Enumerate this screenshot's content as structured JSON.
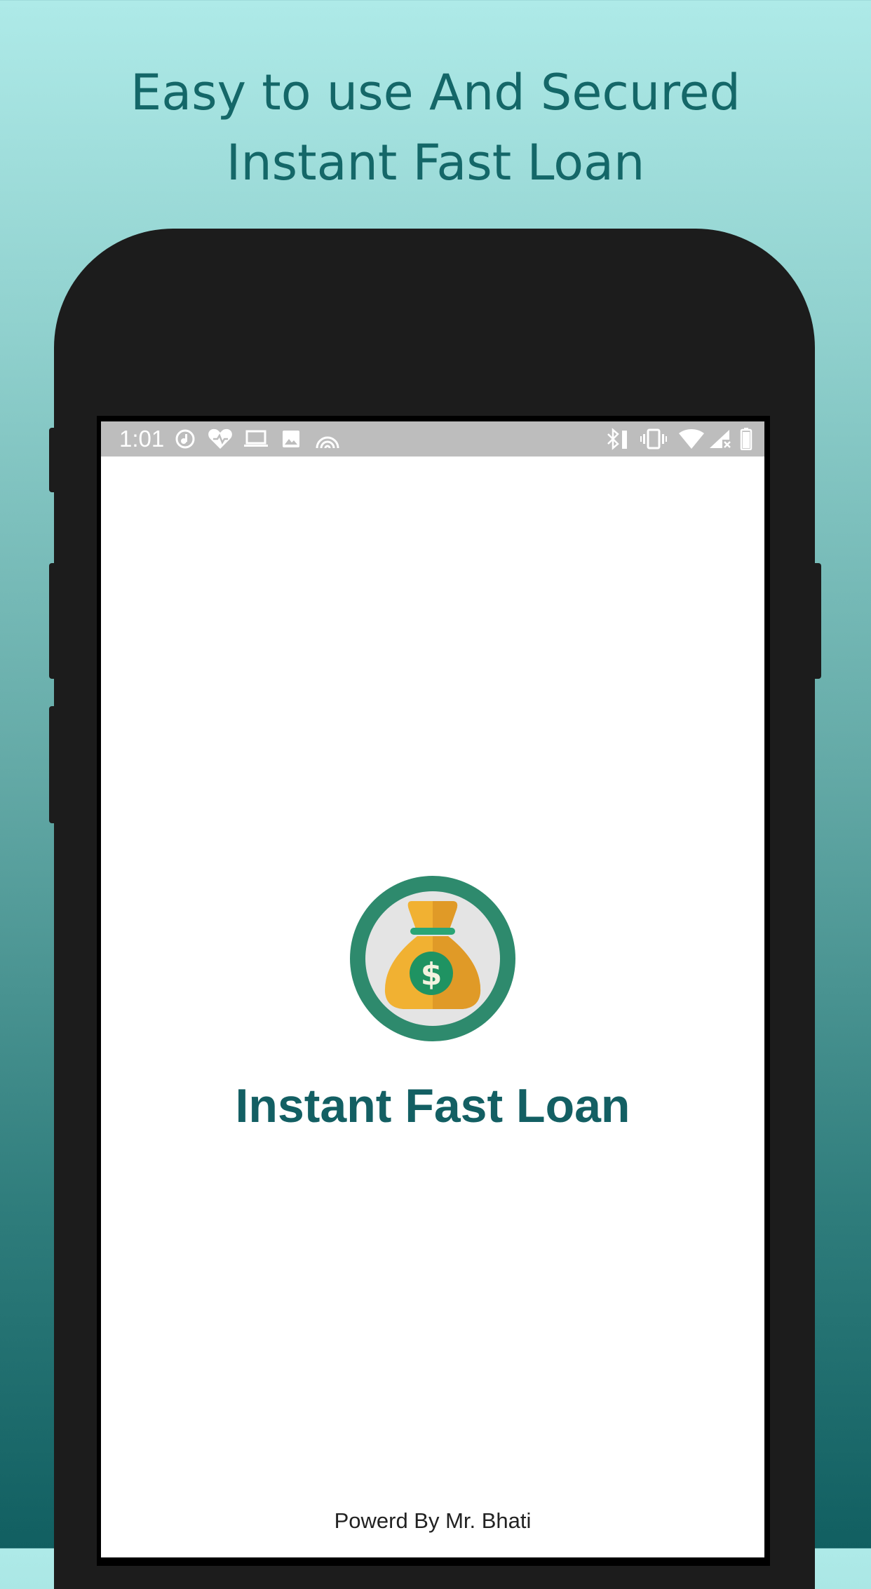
{
  "headline": {
    "line1": "Easy to use And Secured",
    "line2": "Instant Fast Loan"
  },
  "status_bar": {
    "time": "1:01",
    "left_icons": [
      "music-note-icon",
      "heart-check-icon",
      "laptop-icon",
      "image-icon",
      "rainbow-icon"
    ],
    "right_icons": [
      "bluetooth-icon",
      "vibrate-icon",
      "wifi-icon",
      "signal-icon",
      "battery-icon"
    ]
  },
  "app": {
    "title": "Instant Fast Loan",
    "logo_icon": "money-bag-icon",
    "powered_by": "Powerd By Mr. Bhati"
  },
  "colors": {
    "headline": "#146768",
    "title": "#135f63",
    "logo_ring": "#2e8a6d",
    "logo_bag": "#f1b132",
    "status_bar": "#bdbdbd",
    "phone": "#1c1c1c"
  }
}
